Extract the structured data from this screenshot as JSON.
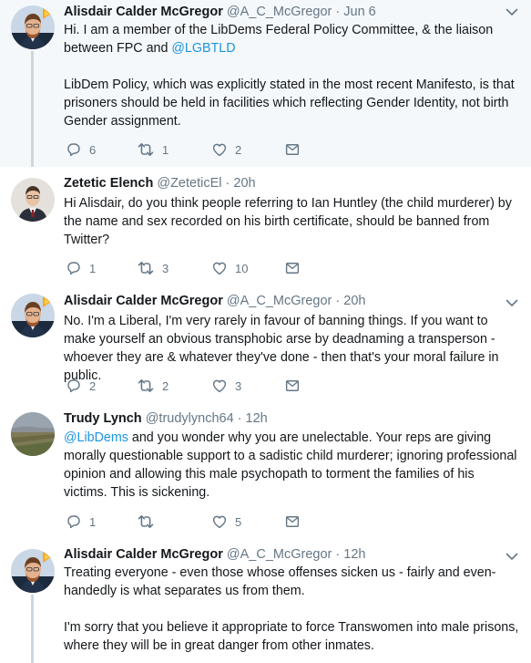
{
  "tweets": [
    {
      "name": "Alisdair Calder McGregor",
      "handle": "@A_C_McGregor",
      "time": "Jun 6",
      "avatar_icon": "person-with-logo-avatar",
      "text_parts": [
        "Hi. I am a member of the LibDems Federal Policy Committee, & the liaison between FPC and ",
        "@LGBTLD",
        "LibDem Policy, which was explicitly stated in the most recent Manifesto, is that prisoners should be held in facilities which reflecting Gender Identity, not birth Gender assignment."
      ],
      "replies": "6",
      "retweets": "1",
      "likes": "2"
    },
    {
      "name": "Zetetic Elench",
      "handle": "@ZeteticEl",
      "time": "20h",
      "avatar_icon": "man-in-suit-avatar",
      "text": "Hi Alisdair, do you think people referring to Ian Huntley (the child murderer) by the name and sex recorded on his birth certificate, should be banned from Twitter?",
      "replies": "1",
      "retweets": "3",
      "likes": "10"
    },
    {
      "name": "Alisdair Calder McGregor",
      "handle": "@A_C_McGregor",
      "time": "20h",
      "avatar_icon": "person-with-logo-avatar",
      "text": "No. I'm a Liberal, I'm very rarely in favour of banning things. If you want to make yourself an obvious transphobic arse by deadnaming a transperson - whoever they are & whatever they've done - then that's your moral failure in public.",
      "replies": "2",
      "retweets": "2",
      "likes": "3"
    },
    {
      "name": "Trudy Lynch",
      "handle": "@trudylynch64",
      "time": "12h",
      "avatar_icon": "landscape-avatar",
      "mention": "@LibDems",
      "text": " and you wonder why you are unelectable. Your reps are giving morally questionable support to a sadistic child murderer; ignoring professional opinion and allowing this male psychopath to torment the families of his victims. This is sickening.",
      "replies": "1",
      "retweets": "",
      "likes": "5"
    },
    {
      "name": "Alisdair Calder McGregor",
      "handle": "@A_C_McGregor",
      "time": "12h",
      "avatar_icon": "person-with-logo-avatar",
      "text_p1": "Treating everyone - even those whose offenses sicken us - fairly and even-handedly is what separates us from them.",
      "text_p2": "I'm sorry that you believe it appropriate to force Transwomen into male prisons, where they will be in great danger from other inmates."
    }
  ],
  "separator": "·",
  "colors": {
    "highlight_bg": "#f5f8fa",
    "text": "#14171a",
    "muted": "#657786",
    "link": "#1b95e0",
    "thread_line": "#ccd6dd"
  }
}
